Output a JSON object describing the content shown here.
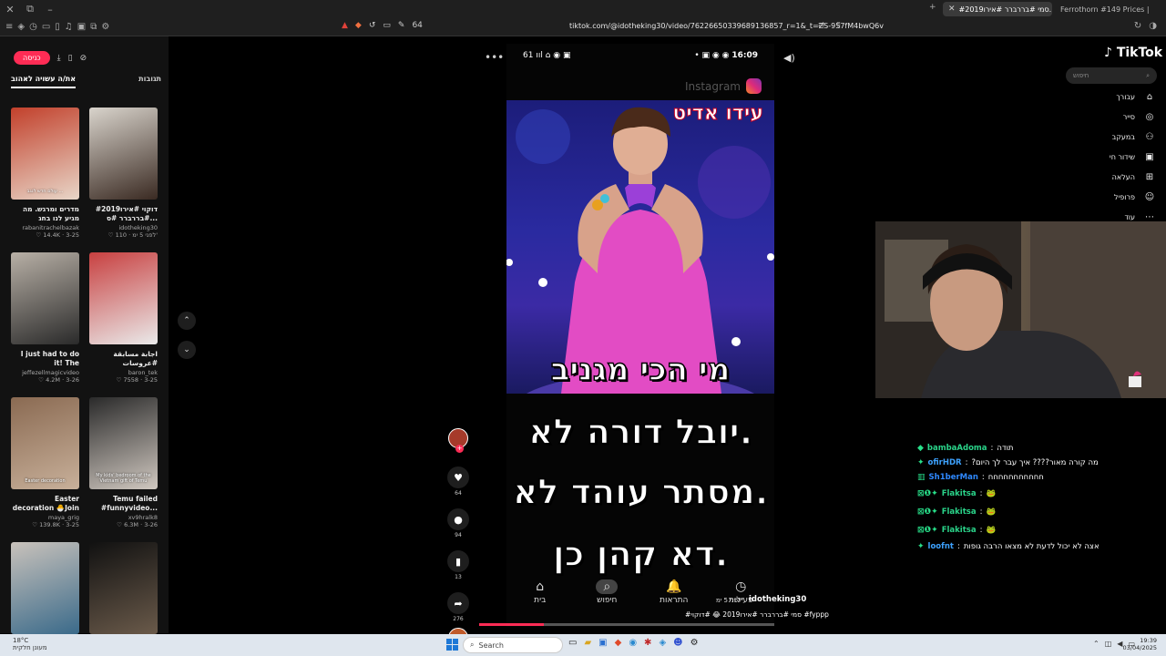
{
  "browser": {
    "tabs": [
      {
        "title": "#סמי #בררברר #אירו2019...",
        "active": true
      },
      {
        "title": "Ferrothorn #149 Prices | Pokemon W...",
        "active": false
      }
    ],
    "url": "tiktok.com/@idotheking30/video/7622665033968913685​7_r=1&_t=ZS-957fM4bwQ6v",
    "ext_badge": "64"
  },
  "left_panel": {
    "login_label": "כניסה",
    "tabs": {
      "liked": "את/ה עשויה לאהוב",
      "comments": "תגובות"
    },
    "cards": [
      {
        "thumb_caption": "עולם חדש לנגב ...",
        "caption": "מדרים ומרגש. מה מגיע לנו בחג הפסח...",
        "author": "rabanitrachelbazak",
        "date": "3-25",
        "likes": "14.4K",
        "colors": [
          "#c2402b",
          "#e8d6c8"
        ]
      },
      {
        "thumb_caption": "",
        "caption": "#דוקוי #אירו2019 #בררברר #ס...",
        "author": "idotheking30",
        "date": "לפני 5 ימ'",
        "likes": "110",
        "colors": [
          "#d9d4cc",
          "#3a2a22"
        ]
      },
      {
        "thumb_caption": "",
        "caption": "I just had to do it! The reactions!...",
        "author": "jeffezellmagicvideo",
        "date": "3-26",
        "likes": "4.2M",
        "colors": [
          "#b8b0a6",
          "#2a2a2a"
        ]
      },
      {
        "thumb_caption": "",
        "caption": "اجابة مسابقة #عروسات #مشاهات #fyp...",
        "author": "baron_tek",
        "date": "3-25",
        "likes": "7558",
        "colors": [
          "#c84040",
          "#eaeaea"
        ]
      },
      {
        "thumb_caption": "Easter decoration",
        "caption": "Easter decoration 🐣Join the page...",
        "author": "maya_grig",
        "date": "3-25",
        "likes": "139.8K",
        "colors": [
          "#8a6a52",
          "#c8b09a"
        ]
      },
      {
        "thumb_caption": "My kids' bedroom of the Vietnam gift of Temu",
        "caption": "Temu failed #funnyvideo...",
        "author": "xv9hralk8",
        "date": "3-26",
        "likes": "6.3M",
        "colors": [
          "#2a2a2a",
          "#d0c8c0"
        ]
      },
      {
        "thumb_caption": "",
        "caption": "",
        "author": "",
        "date": "",
        "likes": "",
        "colors": [
          "#c9c2bb",
          "#3a6a8a"
        ]
      },
      {
        "thumb_caption": "",
        "caption": "",
        "author": "",
        "date": "",
        "likes": "",
        "colors": [
          "#111111",
          "#6a5a4a"
        ]
      }
    ]
  },
  "video": {
    "status_left": "61",
    "status_time": "16:09",
    "instagram_label": "Instagram",
    "edit_label": "עידו אדיט",
    "lines": [
      "מי הכי מגניב",
      "יובל דורה לא.",
      "מסתר עוהד לא.",
      "דא קהן כן."
    ],
    "phone_nav": [
      {
        "icon": "⌂",
        "label": "בית",
        "selected": false
      },
      {
        "icon": "⌕",
        "label": "חיפוש",
        "selected": true
      },
      {
        "icon": "🔔",
        "label": "התראות",
        "selected": false
      },
      {
        "icon": "◷",
        "label": "פעילות",
        "selected": false
      }
    ],
    "author": "idotheking30",
    "posted": "לפני 5 ימ'",
    "caption": "#סמי #בררברר #אירו2019 😂 #דוקוי #fyppp",
    "progress": 0.22
  },
  "actions": {
    "likes": "64",
    "comments": "94",
    "saves": "13",
    "shares": "276"
  },
  "tiktok_nav": {
    "logo": "TikTok",
    "search_placeholder": "חיפוש",
    "items": [
      {
        "label": "עבורך",
        "icon": "⌂"
      },
      {
        "label": "סייר",
        "icon": "◎"
      },
      {
        "label": "במעקב",
        "icon": "⚇"
      },
      {
        "label": "שידור חי",
        "icon": "▣"
      },
      {
        "label": "העלאה",
        "icon": "⊞"
      },
      {
        "label": "פרופיל",
        "icon": "☺"
      },
      {
        "label": "עוד",
        "icon": "⋯"
      }
    ]
  },
  "chat": [
    {
      "user": "bambaAdoma",
      "msg": "תודה",
      "color": "#2ad48a",
      "badge": "◆"
    },
    {
      "user": "ofirHDR",
      "msg": "?מה קורה מאור???? איך עבר לך היום",
      "color": "#3da2ff",
      "badge": "✦"
    },
    {
      "user": "Sh1berMan",
      "msg": "חחחחחחחחחחח",
      "color": "#2f89ff",
      "badge": "▥"
    },
    {
      "user": "Flakitsa",
      "msg": "🐸",
      "color": "#2ad48a",
      "badge": "⊠❶✦"
    },
    {
      "user": "Flakitsa",
      "msg": "🐸",
      "color": "#2ad48a",
      "badge": "⊠❶✦"
    },
    {
      "user": "Flakitsa",
      "msg": "🐸",
      "color": "#2ad48a",
      "badge": "⊠❶✦"
    },
    {
      "user": "loofnt",
      "msg": "אצה לא יכול לדעת לא מצאו הרבה גופות",
      "color": "#3da2ff",
      "badge": "✦"
    }
  ],
  "taskbar": {
    "weather_temp": "18°C",
    "weather_desc": "מעונן חלקית",
    "search_label": "Search",
    "time": "19:39",
    "date": "03/04/2025"
  }
}
